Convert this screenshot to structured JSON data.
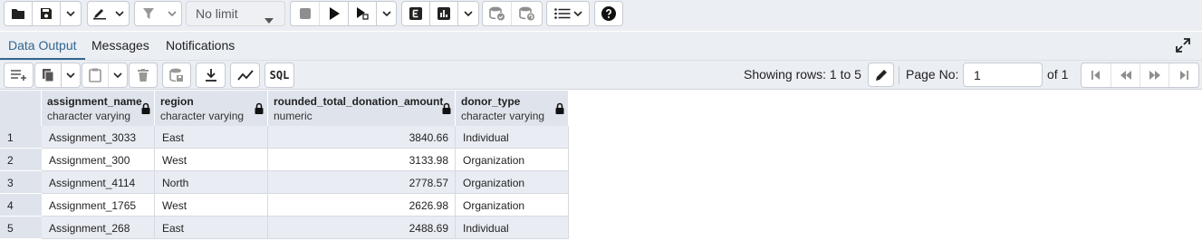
{
  "toolbar": {
    "limit_value": "No limit",
    "icons": [
      "folder-icon",
      "save-icon",
      "chevron-down-icon",
      "pencil-icon",
      "chevron-down-icon",
      "filter-icon",
      "chevron-down-icon",
      "stop-icon",
      "play-icon",
      "play-script-icon",
      "chevron-down-icon",
      "explain-icon",
      "explain-analyze-icon",
      "chevron-down-icon",
      "commit-icon",
      "rollback-icon",
      "macros-icon",
      "chevron-down-icon",
      "help-icon"
    ]
  },
  "tabs": [
    {
      "label": "Data Output",
      "active": true
    },
    {
      "label": "Messages",
      "active": false
    },
    {
      "label": "Notifications",
      "active": false
    }
  ],
  "results_toolbar": {
    "sql_label": "SQL",
    "showing_text": "Showing rows: 1 to 5",
    "page_no_label": "Page No:",
    "page_value": "1",
    "of_pages": "of 1"
  },
  "grid": {
    "columns": [
      {
        "name": "assignment_name",
        "type": "character varying"
      },
      {
        "name": "region",
        "type": "character varying"
      },
      {
        "name": "rounded_total_donation_amount",
        "type": "numeric"
      },
      {
        "name": "donor_type",
        "type": "character varying"
      }
    ],
    "rows": [
      {
        "num": "1",
        "cells": [
          "Assignment_3033",
          "East",
          "3840.66",
          "Individual"
        ]
      },
      {
        "num": "2",
        "cells": [
          "Assignment_300",
          "West",
          "3133.98",
          "Organization"
        ]
      },
      {
        "num": "3",
        "cells": [
          "Assignment_4114",
          "North",
          "2778.57",
          "Organization"
        ]
      },
      {
        "num": "4",
        "cells": [
          "Assignment_1765",
          "West",
          "2626.98",
          "Organization"
        ]
      },
      {
        "num": "5",
        "cells": [
          "Assignment_268",
          "East",
          "2488.69",
          "Individual"
        ]
      }
    ]
  },
  "colors": {
    "accent": "#326690",
    "toolbar_bg": "#ebeef3",
    "header_bg": "#dfe4ec",
    "odd_row_bg": "#e9edf3"
  }
}
